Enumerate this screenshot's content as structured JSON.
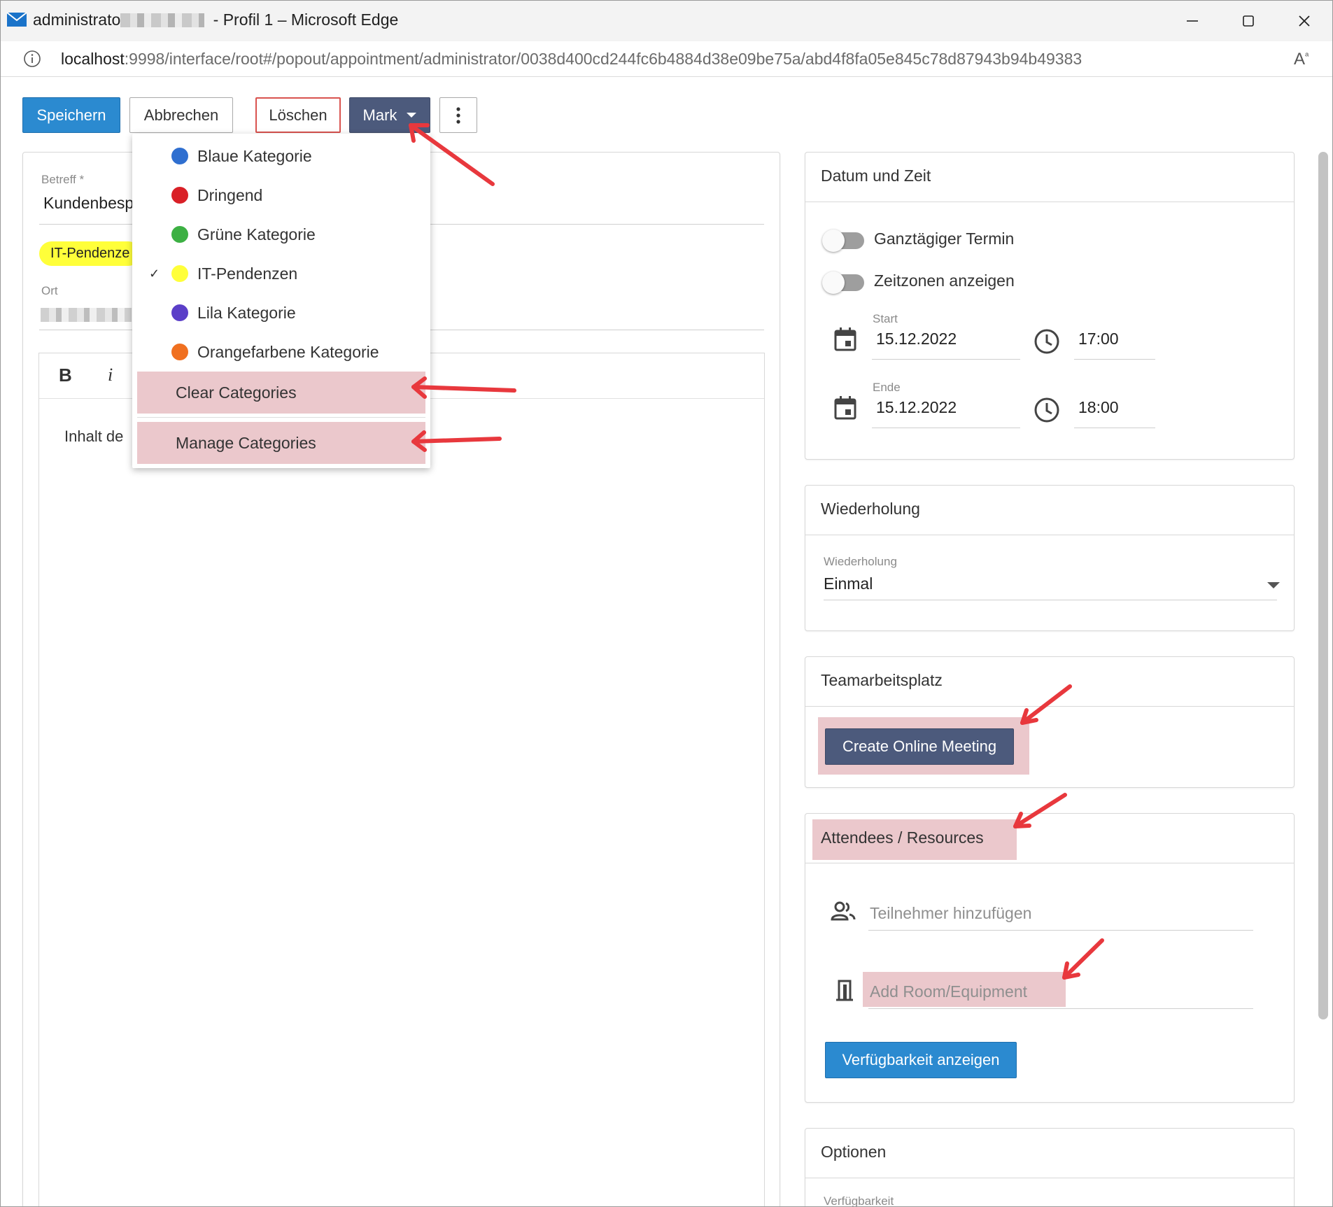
{
  "window": {
    "title_prefix": "administrato",
    "title_suffix": " - Profil 1 – Microsoft Edge",
    "url_host": "localhost",
    "url_path": ":9998/interface/root#/popout/appointment/administrator/0038d400cd244fc6b4884d38e09be75a/abd4f8fa05e845c78d87943b94b49383"
  },
  "toolbar": {
    "save": "Speichern",
    "cancel": "Abbrechen",
    "delete": "Löschen",
    "mark": "Mark"
  },
  "form": {
    "subject_label": "Betreff *",
    "subject_value": "Kundenbesp",
    "category_chip": "IT-Pendenze",
    "location_label": "Ort",
    "editor_bold": "B",
    "editor_italic": "i",
    "editor_body": "Inhalt de"
  },
  "menu": {
    "items": [
      {
        "label": "Blaue Kategorie",
        "color": "#2f6fd0",
        "checked": false
      },
      {
        "label": "Dringend",
        "color": "#d92027",
        "checked": false
      },
      {
        "label": "Grüne Kategorie",
        "color": "#3cb043",
        "checked": false
      },
      {
        "label": "IT-Pendenzen",
        "color": "#ffff3a",
        "checked": true
      },
      {
        "label": "Lila Kategorie",
        "color": "#5b3fc8",
        "checked": false
      },
      {
        "label": "Orangefarbene Kategorie",
        "color": "#f07020",
        "checked": false
      }
    ],
    "check_glyph": "✓",
    "clear": "Clear Categories",
    "manage": "Manage Categories"
  },
  "datetime": {
    "title": "Datum und Zeit",
    "allday": "Ganztägiger Termin",
    "timezones": "Zeitzonen anzeigen",
    "start_label": "Start",
    "start_date": "15.12.2022",
    "start_time": "17:00",
    "end_label": "Ende",
    "end_date": "15.12.2022",
    "end_time": "18:00"
  },
  "recurrence": {
    "title": "Wiederholung",
    "label": "Wiederholung",
    "value": "Einmal"
  },
  "teams": {
    "title": "Teamarbeitsplatz",
    "button": "Create Online Meeting"
  },
  "attendees": {
    "title": "Attendees / Resources",
    "add_attendee_placeholder": "Teilnehmer hinzufügen",
    "add_room_placeholder": "Add Room/Equipment",
    "availability_button": "Verfügbarkeit anzeigen"
  },
  "options": {
    "title": "Optionen",
    "availability_label": "Verfügbarkeit"
  },
  "colors": {
    "primary": "#2b8ad0",
    "mark": "#4c5a7c",
    "danger": "#d9534f",
    "highlight": "#ebc8cc",
    "arrow": "#e8383d"
  }
}
